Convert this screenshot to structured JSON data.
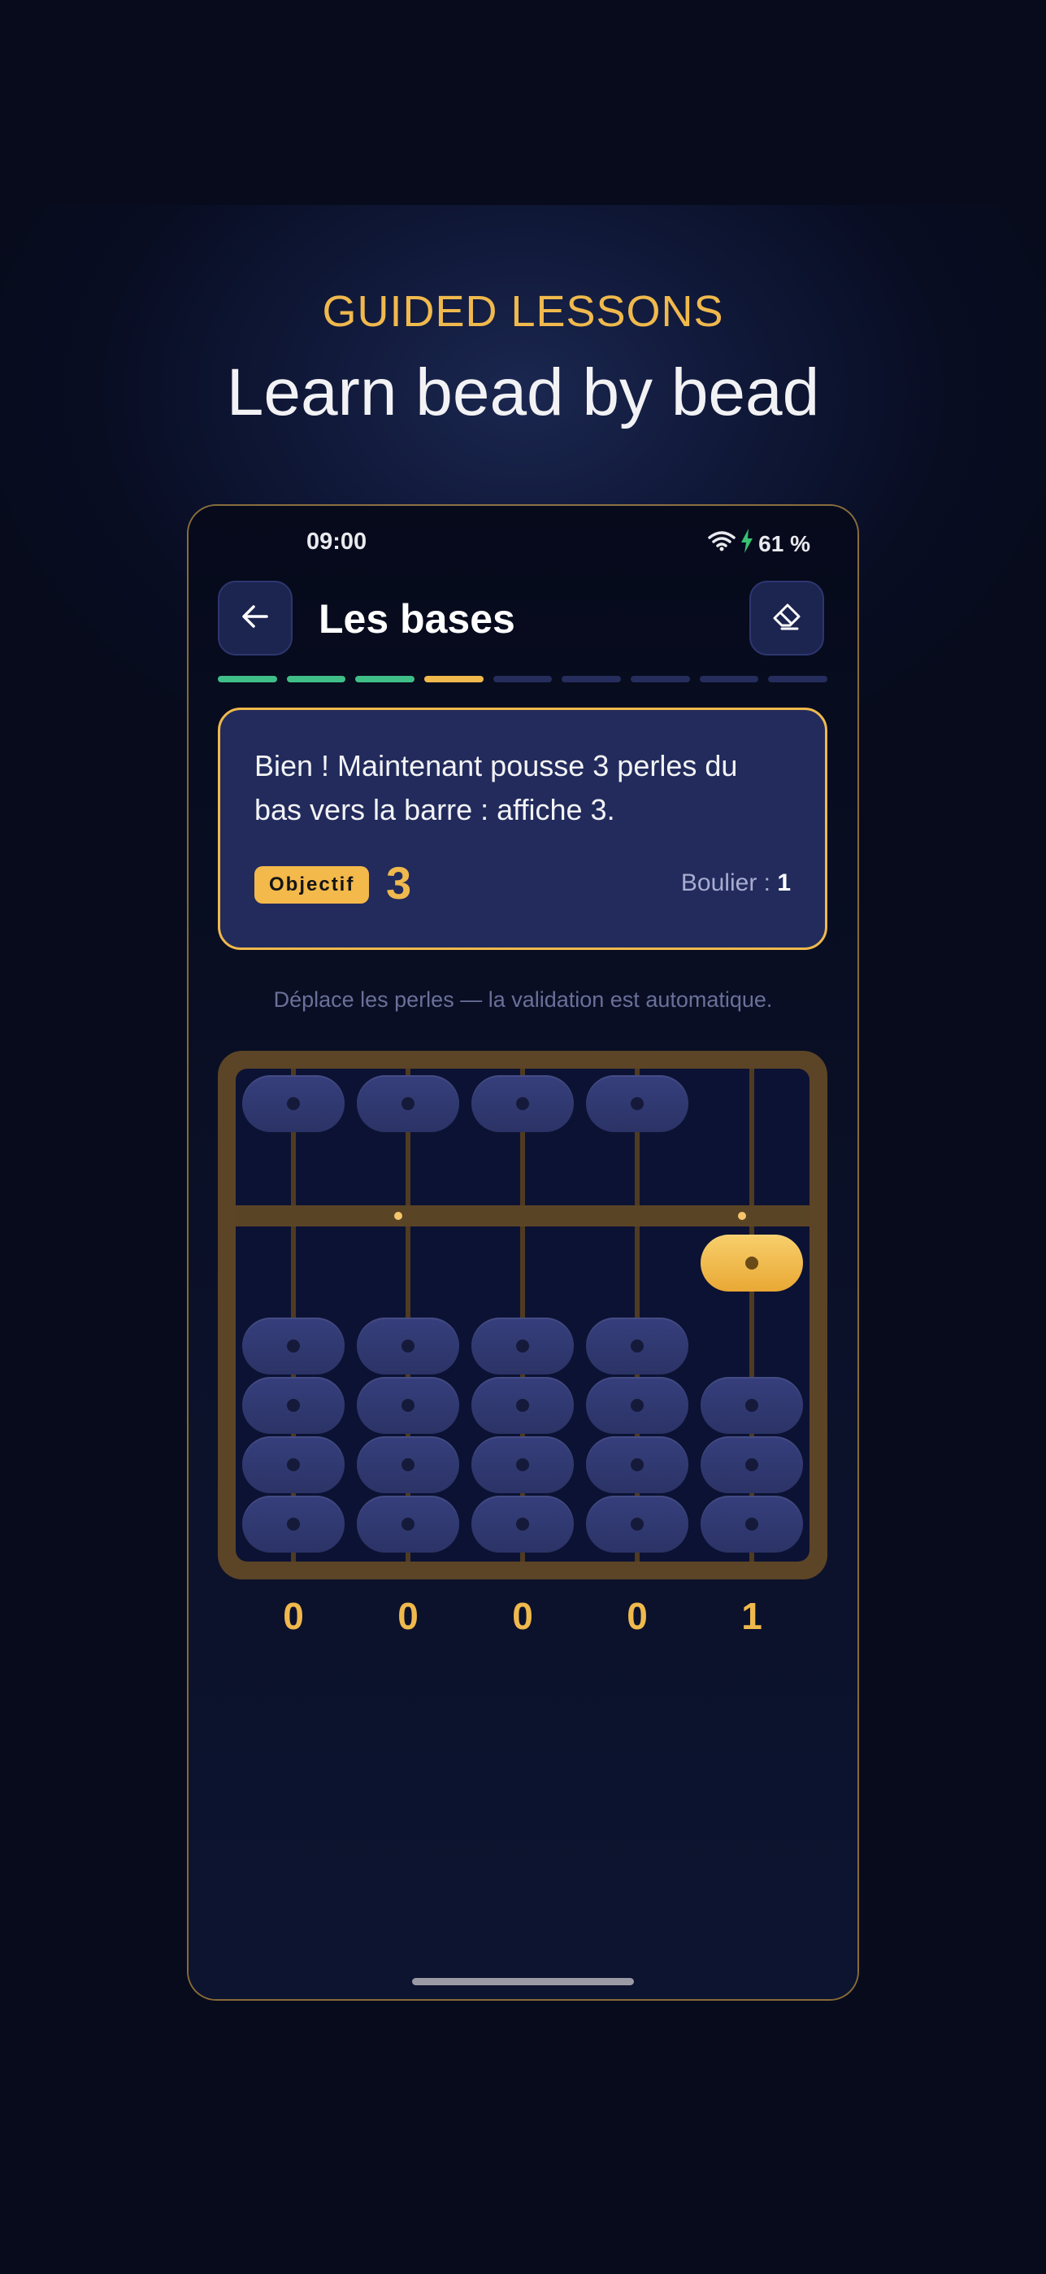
{
  "promo": {
    "eyebrow": "GUIDED LESSONS",
    "headline": "Learn bead by bead"
  },
  "status_bar": {
    "time": "09:00",
    "battery": "61 %",
    "icons": [
      "wifi-icon",
      "charging-bolt-icon"
    ]
  },
  "header": {
    "title": "Les bases",
    "back_icon": "arrow-left-icon",
    "reset_icon": "eraser-icon"
  },
  "progress": {
    "segments": [
      "done",
      "done",
      "done",
      "current",
      "todo",
      "todo",
      "todo",
      "todo",
      "todo"
    ],
    "colors": {
      "done": "#3fbf87",
      "current": "#f0b94d",
      "todo": "#252d5c"
    }
  },
  "lesson_card": {
    "instruction": "Bien ! Maintenant pousse 3 perles du bas vers la barre : affiche 3.",
    "objective_label": "Objectif",
    "objective_value": "3",
    "abacus_label": "Boulier : ",
    "abacus_value": "1"
  },
  "hint": "Déplace les perles — la validation est automatique.",
  "abacus": {
    "columns": 5,
    "upper_beads_active": [
      false,
      false,
      false,
      false,
      true
    ],
    "lower_beads_active": [
      0,
      0,
      0,
      0,
      0
    ],
    "digits": [
      "0",
      "0",
      "0",
      "0",
      "1"
    ],
    "colors": {
      "bead": "#333b77",
      "active_bead": "#f2ba4a",
      "frame": "#5c4426"
    }
  }
}
